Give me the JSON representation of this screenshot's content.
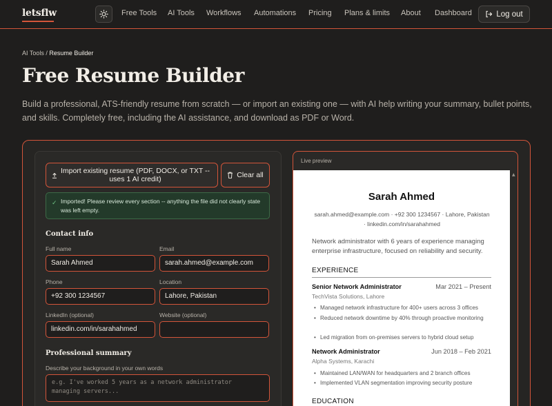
{
  "nav": {
    "logo": "letsflw",
    "links": [
      "Free Tools",
      "AI Tools",
      "Workflows",
      "Automations",
      "Pricing",
      "Plans & limits",
      "About",
      "Dashboard"
    ],
    "logout": "Log out"
  },
  "breadcrumb": {
    "parent": "AI Tools",
    "sep": " / ",
    "current": "Resume Builder"
  },
  "header": {
    "title": "Free Resume Builder",
    "description": "Build a professional, ATS-friendly resume from scratch — or import an existing one — with AI help writing your summary, bullet points, and skills. Completely free, including the AI assistance, and download as PDF or Word."
  },
  "form": {
    "import_label": "Import existing resume (PDF, DOCX, or TXT -- uses 1 AI credit)",
    "clear_label": "Clear all",
    "alert": "Imported! Please review every section -- anything the file did not clearly state was left empty.",
    "contact_heading": "Contact info",
    "fields": {
      "full_name_label": "Full name",
      "full_name": "Sarah Ahmed",
      "email_label": "Email",
      "email": "sarah.ahmed@example.com",
      "phone_label": "Phone",
      "phone": "+92 300 1234567",
      "location_label": "Location",
      "location": "Lahore, Pakistan",
      "linkedin_label": "LinkedIn (optional)",
      "linkedin": "linkedin.com/in/sarahahmed",
      "website_label": "Website (optional)",
      "website": ""
    },
    "summary_heading": "Professional summary",
    "summary_label": "Describe your background in your own words",
    "summary_placeholder": "e.g. I've worked 5 years as a network administrator\nmanaging servers..."
  },
  "preview": {
    "label": "Live preview",
    "name": "Sarah Ahmed",
    "contact": "sarah.ahmed@example.com · +92 300 1234567 · Lahore, Pakistan · linkedin.com/in/sarahahmed",
    "summary": "Network administrator with 6 years of experience managing enterprise infrastructure, focused on reliability and security.",
    "experience_heading": "EXPERIENCE",
    "jobs": [
      {
        "title": "Senior Network Administrator",
        "dates": "Mar 2021 – Present",
        "company": "TechVista Solutions, Lahore",
        "bullets": [
          "Managed network infrastructure for 400+ users across 3 offices",
          "Reduced network downtime by 40% through proactive monitoring",
          "Led migration from on-premises servers to hybrid cloud setup"
        ]
      },
      {
        "title": "Network Administrator",
        "dates": "Jun 2018 – Feb 2021",
        "company": "Alpha Systems, Karachi",
        "bullets": [
          "Maintained LAN/WAN for headquarters and 2 branch offices",
          "Implemented VLAN segmentation improving security posture"
        ]
      }
    ],
    "education_heading": "EDUCATION"
  }
}
